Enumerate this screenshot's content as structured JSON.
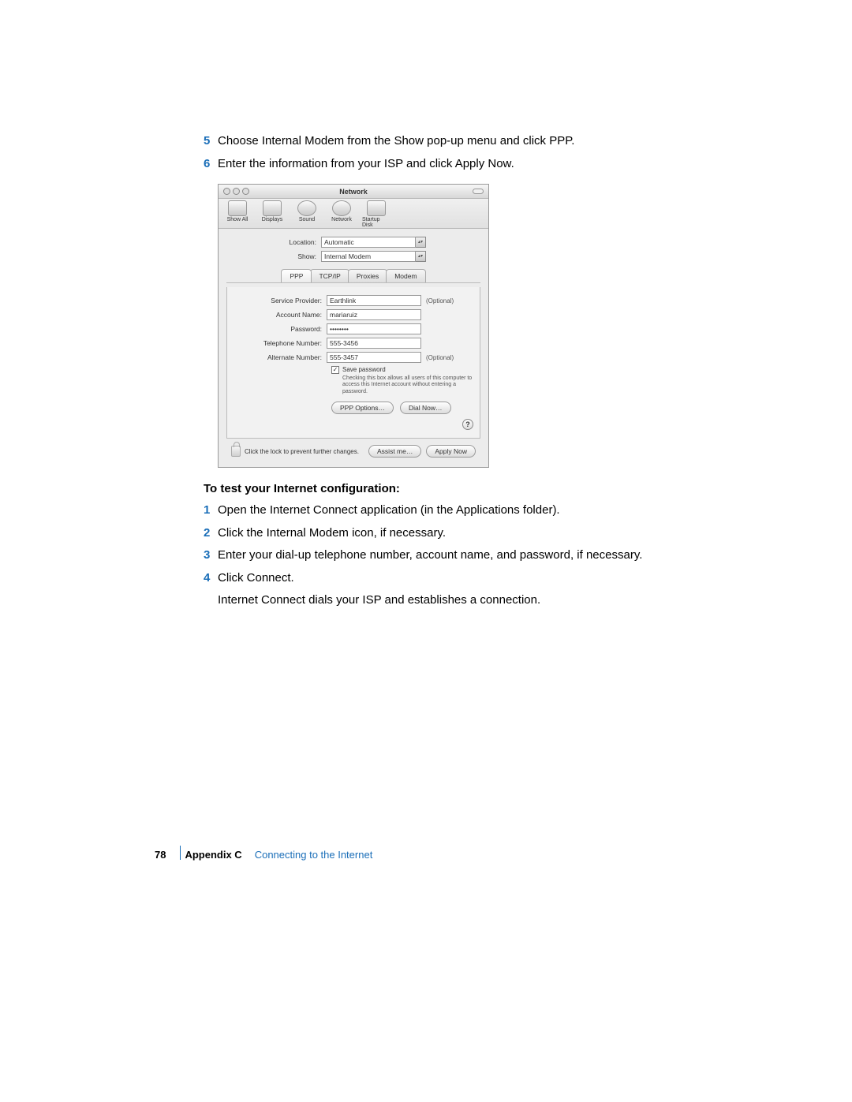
{
  "steps_top": [
    {
      "num": "5",
      "text": "Choose Internal Modem from the Show pop-up menu and click PPP."
    },
    {
      "num": "6",
      "text": "Enter the information from your ISP and click Apply Now."
    }
  ],
  "window": {
    "title": "Network",
    "toolbar": {
      "show_all": "Show All",
      "displays": "Displays",
      "sound": "Sound",
      "network": "Network",
      "startup_disk": "Startup Disk"
    },
    "location_label": "Location:",
    "location_value": "Automatic",
    "show_label": "Show:",
    "show_value": "Internal Modem",
    "tabs": {
      "ppp": "PPP",
      "tcpip": "TCP/IP",
      "proxies": "Proxies",
      "modem": "Modem"
    },
    "fields": {
      "service_provider_label": "Service Provider:",
      "service_provider_value": "Earthlink",
      "service_provider_suffix": "(Optional)",
      "account_name_label": "Account Name:",
      "account_name_value": "mariaruiz",
      "password_label": "Password:",
      "password_value": "••••••••",
      "telephone_label": "Telephone Number:",
      "telephone_value": "555-3456",
      "alternate_label": "Alternate Number:",
      "alternate_value": "555-3457",
      "alternate_suffix": "(Optional)",
      "save_password_label": "Save password",
      "save_password_hint": "Checking this box allows all users of this computer to access this Internet account without entering a password."
    },
    "buttons": {
      "ppp_options": "PPP Options…",
      "dial_now": "Dial Now…",
      "help": "?",
      "assist_me": "Assist me…",
      "apply_now": "Apply Now"
    },
    "lock_text": "Click the lock to prevent further changes."
  },
  "subhead": "To test your Internet configuration:",
  "steps_bottom": [
    {
      "num": "1",
      "text": "Open the Internet Connect application (in the Applications folder)."
    },
    {
      "num": "2",
      "text": "Click the Internal Modem icon, if necessary."
    },
    {
      "num": "3",
      "text": "Enter your dial-up telephone number, account name, and password, if necessary."
    },
    {
      "num": "4",
      "text": "Click Connect."
    }
  ],
  "closing_text": "Internet Connect dials your ISP and establishes a connection.",
  "footer": {
    "page_num": "78",
    "appendix_label": "Appendix C",
    "appendix_title": "Connecting to the Internet"
  }
}
